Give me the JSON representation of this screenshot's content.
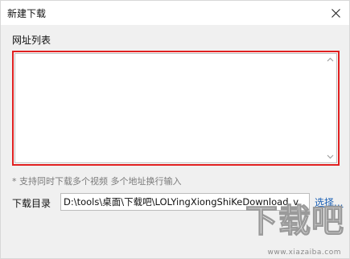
{
  "window": {
    "title": "新建下载"
  },
  "url_list": {
    "label": "网址列表",
    "value": ""
  },
  "hint": "* 支持同时下载多个视频 多个地址换行输入",
  "directory": {
    "label": "下载目录",
    "value": "D:\\tools\\桌面\\下载吧\\LOLYingXiongShiKeDownload_v",
    "browse_label": "选择..."
  },
  "watermark": {
    "text": "下载吧",
    "url": "www.xiazaiba.com"
  },
  "colors": {
    "highlight_border": "#e02020",
    "link": "#1a5fb4",
    "dialog_bg": "#f0f0f0"
  }
}
